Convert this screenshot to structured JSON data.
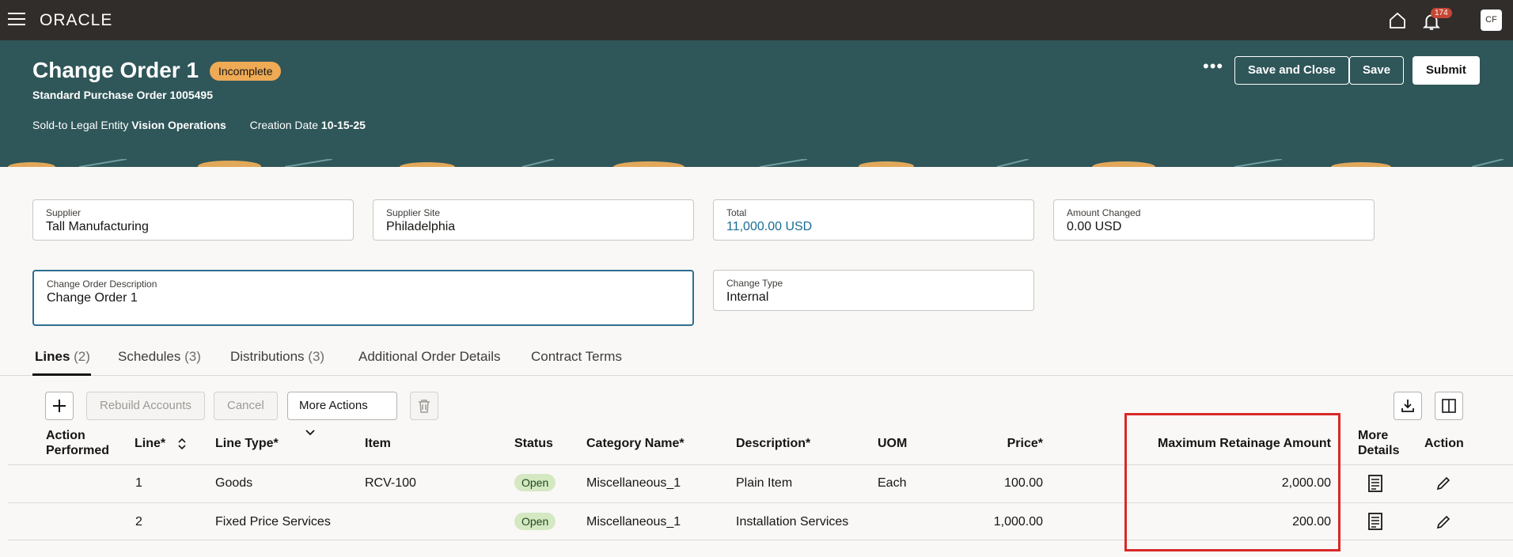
{
  "topbar": {
    "logo": "ORACLE",
    "notification_count": "174",
    "avatar_initials": "CF"
  },
  "header": {
    "title": "Change Order 1",
    "status": "Incomplete",
    "subtitle": "Standard Purchase Order 1005495",
    "sold_to_label": "Sold-to Legal Entity",
    "sold_to_value": "Vision Operations",
    "creation_label": "Creation Date",
    "creation_value": "10-15-25",
    "buttons": {
      "save_and_close": "Save and Close",
      "save": "Save",
      "submit": "Submit"
    }
  },
  "fields": {
    "supplier": {
      "label": "Supplier",
      "value": "Tall Manufacturing"
    },
    "supplier_site": {
      "label": "Supplier Site",
      "value": "Philadelphia"
    },
    "total": {
      "label": "Total",
      "value": "11,000.00 USD"
    },
    "amount_changed": {
      "label": "Amount Changed",
      "value": "0.00 USD"
    },
    "description": {
      "label": "Change Order Description",
      "value": "Change Order 1"
    },
    "change_type": {
      "label": "Change Type",
      "value": "Internal"
    }
  },
  "tabs": [
    {
      "label": "Lines",
      "count": "(2)"
    },
    {
      "label": "Schedules",
      "count": "(3)"
    },
    {
      "label": "Distributions",
      "count": "(3)"
    },
    {
      "label": "Additional Order Details",
      "count": ""
    },
    {
      "label": "Contract Terms",
      "count": ""
    }
  ],
  "toolbar": {
    "rebuild": "Rebuild Accounts",
    "cancel": "Cancel",
    "more_actions": "More Actions"
  },
  "table": {
    "headers": {
      "action_performed_1": "Action",
      "action_performed_2": "Performed",
      "line": "Line*",
      "line_type": "Line Type*",
      "item": "Item",
      "status": "Status",
      "category": "Category Name*",
      "description": "Description*",
      "uom": "UOM",
      "price": "Price*",
      "max_retainage": "Maximum Retainage Amount",
      "more_details_1": "More",
      "more_details_2": "Details",
      "action": "Action"
    },
    "rows": [
      {
        "line": "1",
        "line_type": "Goods",
        "item": "RCV-100",
        "status": "Open",
        "category": "Miscellaneous_1",
        "description": "Plain Item",
        "uom": "Each",
        "price": "100.00",
        "max_retainage": "2,000.00"
      },
      {
        "line": "2",
        "line_type": "Fixed Price Services",
        "item": "",
        "status": "Open",
        "category": "Miscellaneous_1",
        "description": "Installation Services",
        "uom": "",
        "price": "1,000.00",
        "max_retainage": "200.00"
      }
    ]
  }
}
